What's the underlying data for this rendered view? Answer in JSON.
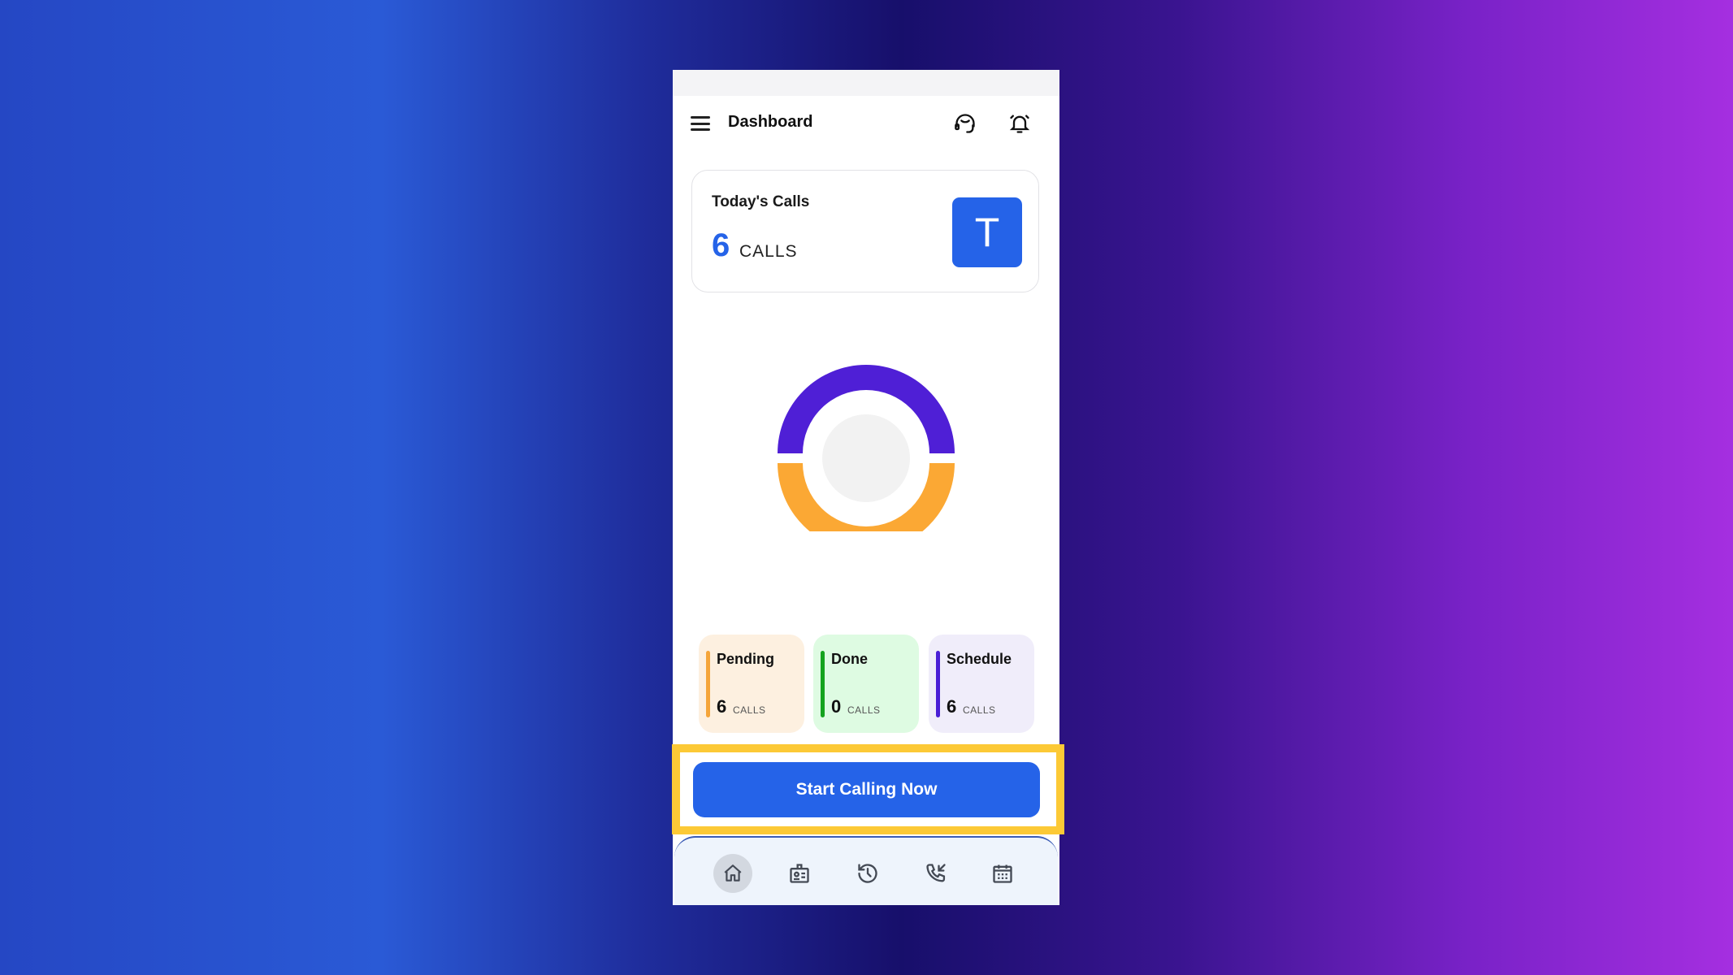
{
  "header": {
    "title": "Dashboard",
    "menu_icon": "hamburger-menu-icon",
    "support_icon": "headset-icon",
    "notification_icon": "bell-ringing-icon"
  },
  "todays_calls": {
    "label": "Today's Calls",
    "count": "6",
    "unit": "CALLS",
    "avatar_letter": "T"
  },
  "chart_data": {
    "type": "pie",
    "style": "donut",
    "categories": [
      "Schedule",
      "Pending",
      "Done"
    ],
    "values": [
      6,
      6,
      0
    ],
    "colors": [
      "#4f1fd6",
      "#fba834",
      "#1aa32a"
    ]
  },
  "stats": [
    {
      "name": "Pending",
      "count": "6",
      "unit": "CALLS",
      "accent": "#f5a53a",
      "bg": "#fdf0e0"
    },
    {
      "name": "Done",
      "count": "0",
      "unit": "CALLS",
      "accent": "#14a31e",
      "bg": "#defbe2"
    },
    {
      "name": "Schedule",
      "count": "6",
      "unit": "CALLS",
      "accent": "#4a1fd6",
      "bg": "#f0edfa"
    }
  ],
  "cta": {
    "label": "Start Calling Now",
    "color": "#2563e8",
    "highlight_color": "#fcc936"
  },
  "nav": [
    {
      "icon": "home-icon",
      "active": true
    },
    {
      "icon": "contact-card-icon",
      "active": false
    },
    {
      "icon": "history-icon",
      "active": false
    },
    {
      "icon": "incoming-call-icon",
      "active": false
    },
    {
      "icon": "calendar-icon",
      "active": false
    }
  ]
}
